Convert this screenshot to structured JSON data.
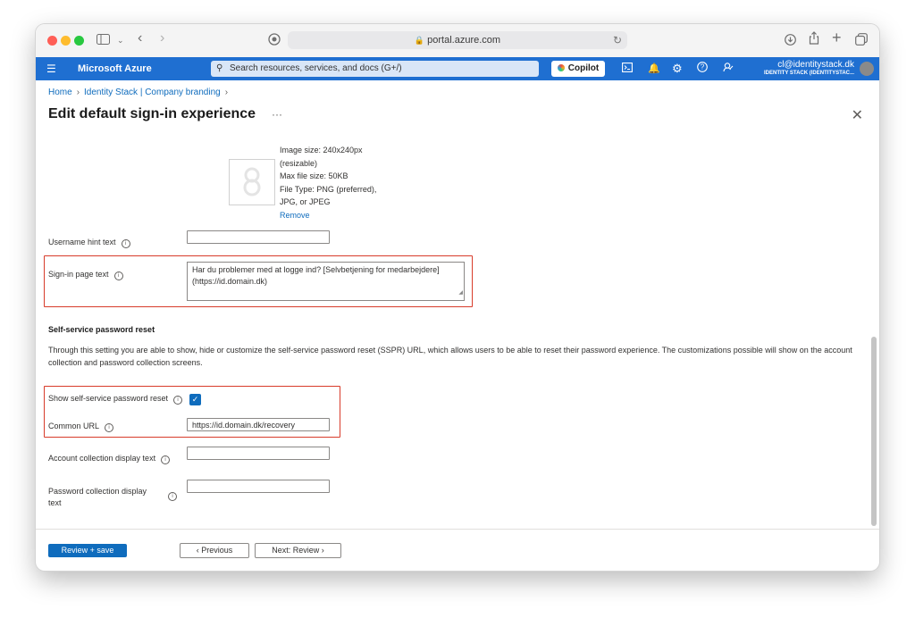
{
  "browser": {
    "url": "portal.azure.com"
  },
  "azure_bar": {
    "brand": "Microsoft Azure",
    "search_placeholder": "Search resources, services, and docs (G+/)",
    "copilot_label": "Copilot",
    "account_user": "cl@identitystack.dk",
    "account_org": "IDENTITY STACK (IDENTITYSTAC..."
  },
  "breadcrumb": {
    "home": "Home",
    "tenant": "Identity Stack | Company branding"
  },
  "page": {
    "title": "Edit default sign-in experience"
  },
  "image_info": {
    "lines": [
      "Image size: 240x240px",
      "(resizable)",
      "Max file size: 50KB",
      "File Type: PNG (preferred),",
      "JPG, or JPEG"
    ],
    "remove_label": "Remove"
  },
  "fields": {
    "username_hint_label": "Username hint text",
    "username_hint_value": "",
    "signin_text_label": "Sign-in page text",
    "signin_text_value_line1": "Har du problemer med at logge ind? [Selvbetjening for medarbejdere]",
    "signin_text_value_line2": "(https://id.domain.dk)"
  },
  "sspr": {
    "heading": "Self-service password reset",
    "description": "Through this setting you are able to show, hide or customize the self-service password reset (SSPR) URL, which allows users to be able to reset their password experience. The customizations possible will show on the account collection and password collection screens.",
    "show_label": "Show self-service password reset",
    "show_checked": true,
    "common_url_label": "Common URL",
    "common_url_value": "https://id.domain.dk/recovery",
    "account_collection_label": "Account collection display text",
    "account_collection_value": "",
    "password_collection_label_line1": "Password collection display",
    "password_collection_label_line2": "text",
    "password_collection_value": ""
  },
  "footer": {
    "review_save": "Review + save",
    "previous": "Previous",
    "next": "Next: Review"
  },
  "colors": {
    "azure_blue": "#1f6fd1",
    "link_blue": "#0f6cbd",
    "highlight_red": "#d83b2a"
  }
}
